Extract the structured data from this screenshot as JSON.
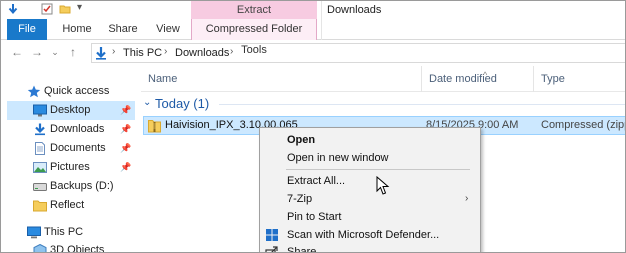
{
  "title_bar": {
    "context_group": "Extract",
    "window_title": "Downloads"
  },
  "ribbon": {
    "tabs": [
      "File",
      "Home",
      "Share",
      "View",
      "Compressed Folder Tools"
    ]
  },
  "address": {
    "crumbs": [
      "This PC",
      "Downloads"
    ]
  },
  "nav_pane": {
    "items": [
      {
        "label": "Quick access",
        "icon": "star-icon",
        "pinned": false
      },
      {
        "label": "Desktop",
        "icon": "desktop-icon",
        "pinned": true,
        "selected": true
      },
      {
        "label": "Downloads",
        "icon": "download-arrow-icon",
        "pinned": true
      },
      {
        "label": "Documents",
        "icon": "document-icon",
        "pinned": true
      },
      {
        "label": "Pictures",
        "icon": "picture-icon",
        "pinned": true
      },
      {
        "label": "Backups (D:)",
        "icon": "drive-icon",
        "pinned": false
      },
      {
        "label": "Reflect",
        "icon": "folder-icon",
        "pinned": false
      },
      {
        "label": "This PC",
        "icon": "computer-icon",
        "pinned": false
      },
      {
        "label": "3D Objects",
        "icon": "cube-icon",
        "pinned": false
      }
    ]
  },
  "columns": {
    "name": "Name",
    "date": "Date modified",
    "type": "Type"
  },
  "group": {
    "label": "Today (1)"
  },
  "file": {
    "name": "Haivision_IPX_3.10.00.065",
    "date": "8/15/2025 9:00 AM",
    "type": "Compressed (zipp..."
  },
  "context_menu": {
    "items": [
      {
        "label": "Open",
        "bold": true
      },
      {
        "label": "Open in new window"
      },
      {
        "label": "Extract All..."
      },
      {
        "label": "7-Zip",
        "submenu": true
      },
      {
        "label": "Pin to Start"
      },
      {
        "label": "Scan with Microsoft Defender...",
        "icon": "defender-icon"
      },
      {
        "label": "Share",
        "icon": "share-icon"
      }
    ]
  },
  "colors": {
    "accent": "#1979ca",
    "selection": "#cce8ff",
    "context_tab": "#f7cbe1",
    "group_text": "#1e5aa7"
  }
}
